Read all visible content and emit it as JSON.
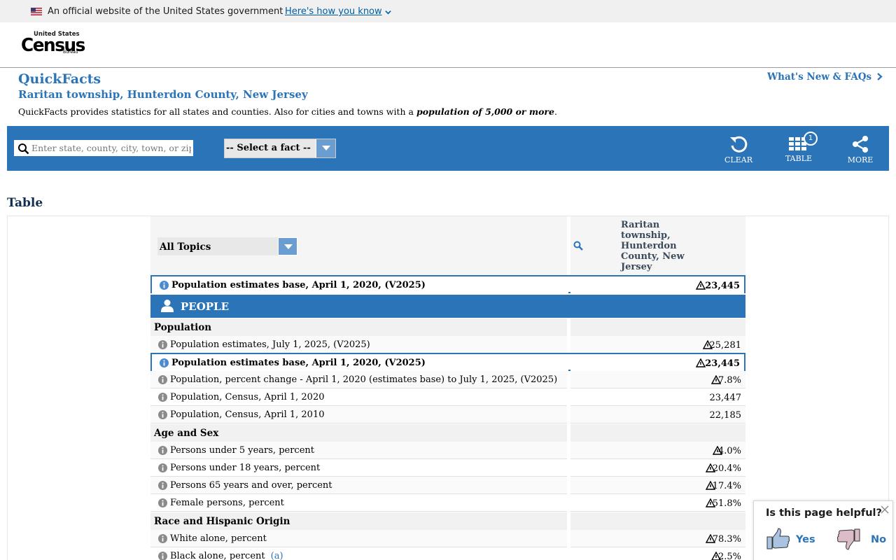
{
  "gov_banner": {
    "official_text": "An official website of the United States government",
    "how_link": "Here's how you know"
  },
  "header": {
    "logo_united_states": "United States",
    "logo_census": "Census",
    "logo_bureau": "Bureau"
  },
  "quickfacts": {
    "title": "QuickFacts",
    "location": "Raritan township, Hunterdon County, New Jersey",
    "description_prefix": "QuickFacts provides statistics for all states and counties. Also for cities and towns with a",
    "description_emphasis": "population of 5,000 or more",
    "description_suffix": ".",
    "whats_new": "What's New & FAQs"
  },
  "toolbar": {
    "search_placeholder": "Enter state, county, city, town, or zip code",
    "select_fact_label": "-- Select a fact --",
    "clear_label": "CLEAR",
    "table_label": "TABLE",
    "table_badge": "1",
    "more_label": "MORE"
  },
  "table": {
    "section_title": "Table",
    "topics_label": "All Topics",
    "column_geo": "Raritan township, Hunterdon County, New Jersey",
    "pinned_row": {
      "label": "Population estimates base, April 1, 2020, (V2025)",
      "value": "23,445"
    },
    "people_label": "PEOPLE",
    "categories": {
      "population": "Population",
      "age_sex": "Age and Sex",
      "race": "Race and Hispanic Origin"
    },
    "rows": [
      {
        "label": "Population estimates, July 1, 2025, (V2025)",
        "value": "25,281"
      },
      {
        "label": "Population estimates base, April 1, 2020, (V2025)",
        "value": "23,445"
      },
      {
        "label": "Population, percent change - April 1, 2020 (estimates base) to July 1, 2025, (V2025)",
        "value": "7.8%"
      },
      {
        "label": "Population, Census, April 1, 2020",
        "value": "23,447"
      },
      {
        "label": "Population, Census, April 1, 2010",
        "value": "22,185"
      },
      {
        "label": "Persons under 5 years, percent",
        "value": "4.0%"
      },
      {
        "label": "Persons under 18 years, percent",
        "value": "20.4%"
      },
      {
        "label": "Persons 65 years and over, percent",
        "value": "17.4%"
      },
      {
        "label": "Female persons, percent",
        "value": "51.8%"
      },
      {
        "label": "White alone, percent",
        "value": "78.3%"
      },
      {
        "label": "Black alone, percent",
        "note": "(a)",
        "value": "2.5%"
      }
    ]
  },
  "feedback": {
    "question": "Is this page helpful?",
    "yes": "Yes",
    "no": "No"
  },
  "colors": {
    "brand_blue": "#2b74b8",
    "dark_navy": "#112e51",
    "link_blue": "#005ea2"
  }
}
